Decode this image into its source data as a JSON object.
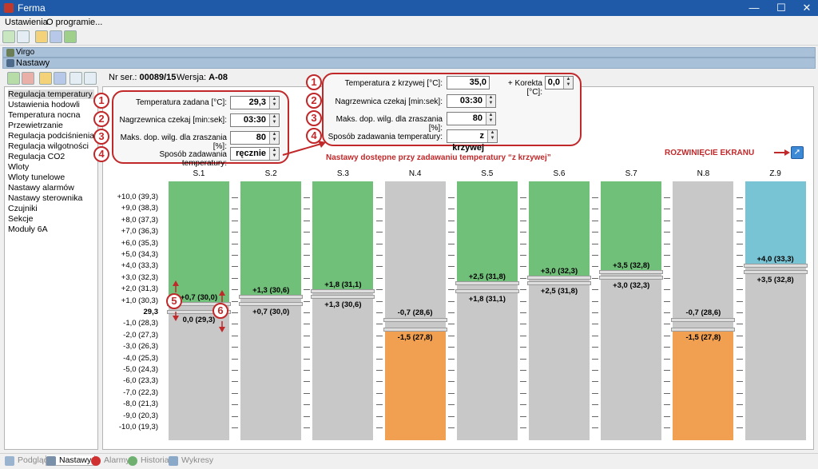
{
  "window": {
    "title": "Ferma"
  },
  "menu": {
    "settings": "Ustawienia",
    "about": "O programie..."
  },
  "groups": {
    "virgo": "Virgo",
    "settings": "Nastawy"
  },
  "meta": {
    "serial_label": "Nr ser.:",
    "serial": "00089/15",
    "version_label": "Wersja:",
    "version": "A-08"
  },
  "sidebar": {
    "items": [
      "Regulacja temperatury",
      "Ustawienia hodowli",
      "Temperatura nocna",
      "Przewietrzanie",
      "Regulacja podciśnienia",
      "Regulacja wilgotności",
      "Regulacja CO2",
      "Wloty",
      "Wloty tunelowe",
      "Nastawy alarmów",
      "Nastawy sterownika",
      "Czujniki",
      "Sekcje",
      "Moduły 6A"
    ]
  },
  "form_left": {
    "set_temp_label": "Temperatura zadana [°C]:",
    "set_temp": "29,3",
    "heat_wait_label": "Nagrzewnica czekaj [min:sek]:",
    "heat_wait": "03:30",
    "max_hum_label": "Maks. dop. wilg. dla zraszania [%]:",
    "max_hum": "80",
    "mode_label": "Sposób zadawania temperatury:",
    "mode": "ręcznie"
  },
  "form_right": {
    "curve_temp_label": "Temperatura z krzywej [°C]:",
    "curve_temp": "35,0",
    "correction_label": "+ Korekta [°C]:",
    "correction": "0,0",
    "heat_wait_label": "Nagrzewnica czekaj [min:sek]:",
    "heat_wait": "03:30",
    "max_hum_label": "Maks. dop. wilg. dla zraszania [%]:",
    "max_hum": "80",
    "mode_label": "Sposób zadawania temperatury:",
    "mode": "z krzywej"
  },
  "badges": [
    "1",
    "2",
    "3",
    "4",
    "5",
    "6"
  ],
  "note_curve": "Nastawy dostępne przy zadawaniu temperatury “z krzywej”",
  "note_expand": "ROZWINIĘCIE EKRANU",
  "chart": {
    "y_ticks": [
      "+10,0 (39,3)",
      "+9,0 (38,3)",
      "+8,0 (37,3)",
      "+7,0 (36,3)",
      "+6,0 (35,3)",
      "+5,0 (34,3)",
      "+4,0 (33,3)",
      "+3,0 (32,3)",
      "+2,0 (31,3)",
      "+1,0 (30,3)",
      "29,3",
      "-1,0 (28,3)",
      "-2,0 (27,3)",
      "-3,0 (26,3)",
      "-4,0 (25,3)",
      "-5,0 (24,3)",
      "-6,0 (23,3)",
      "-7,0 (22,3)",
      "-8,0 (21,3)",
      "-9,0 (20,3)",
      "-10,0 (19,3)"
    ],
    "columns": [
      {
        "name": "S.1",
        "upper": 0.7,
        "lower": 0.0,
        "color": "#70c07a",
        "upper_label": "+0,7 (30,0)",
        "lower_label": "0,0 (29,3)"
      },
      {
        "name": "S.2",
        "upper": 1.3,
        "lower": 0.7,
        "color": "#70c07a",
        "upper_label": "+1,3 (30,6)",
        "lower_label": "+0,7 (30,0)"
      },
      {
        "name": "S.3",
        "upper": 1.8,
        "lower": 1.3,
        "color": "#70c07a",
        "upper_label": "+1,8 (31,1)",
        "lower_label": "+1,3 (30,6)"
      },
      {
        "name": "N.4",
        "upper": -0.7,
        "lower": -1.5,
        "color": "#f0a050",
        "upper_label": "-0,7 (28,6)",
        "lower_label": "-1,5 (27,8)"
      },
      {
        "name": "S.5",
        "upper": 2.5,
        "lower": 1.8,
        "color": "#70c07a",
        "upper_label": "+2,5 (31,8)",
        "lower_label": "+1,8 (31,1)"
      },
      {
        "name": "S.6",
        "upper": 3.0,
        "lower": 2.5,
        "color": "#70c07a",
        "upper_label": "+3,0 (32,3)",
        "lower_label": "+2,5 (31,8)"
      },
      {
        "name": "S.7",
        "upper": 3.5,
        "lower": 3.0,
        "color": "#70c07a",
        "upper_label": "+3,5 (32,8)",
        "lower_label": "+3,0 (32,3)"
      },
      {
        "name": "N.8",
        "upper": -0.7,
        "lower": -1.5,
        "color": "#f0a050",
        "upper_label": "-0,7 (28,6)",
        "lower_label": "-1,5 (27,8)"
      },
      {
        "name": "Z.9",
        "upper": 4.0,
        "lower": 3.5,
        "color": "#78c4d4",
        "upper_label": "+4,0 (33,3)",
        "lower_label": "+3,5 (32,8)"
      }
    ]
  },
  "tabs": {
    "preview": "Podgląd",
    "settings": "Nastawy",
    "alarms": "Alarmy",
    "history": "Historia",
    "charts": "Wykresy"
  }
}
